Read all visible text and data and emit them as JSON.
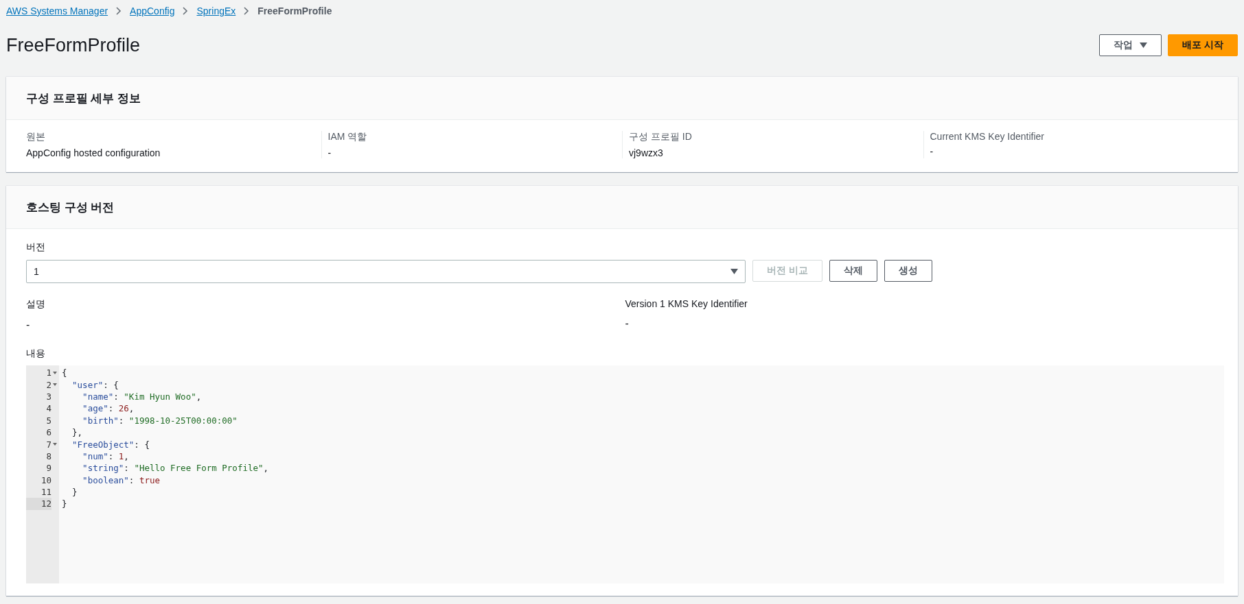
{
  "breadcrumb": [
    {
      "label": "AWS Systems Manager",
      "link": true
    },
    {
      "label": "AppConfig",
      "link": true
    },
    {
      "label": "SpringEx",
      "link": true
    },
    {
      "label": "FreeFormProfile",
      "link": false
    }
  ],
  "header": {
    "title": "FreeFormProfile",
    "actions": [
      {
        "label": "작업",
        "kind": "dropdown"
      },
      {
        "label": "배포 시작",
        "kind": "primary"
      }
    ]
  },
  "details": {
    "title": "구성 프로필 세부 정보",
    "fields": [
      {
        "label": "원본",
        "value": "AppConfig hosted configuration"
      },
      {
        "label": "IAM 역할",
        "value": "-"
      },
      {
        "label": "구성 프로필 ID",
        "value": "vj9wzx3"
      },
      {
        "label": "Current KMS Key Identifier",
        "value": "-"
      }
    ]
  },
  "versions": {
    "title": "호스팅 구성 버전",
    "version_label": "버전",
    "version_select": "1",
    "buttons": [
      {
        "label": "버전 비교",
        "disabled": true
      },
      {
        "label": "삭제",
        "disabled": false
      },
      {
        "label": "생성",
        "disabled": false
      }
    ],
    "fields": [
      {
        "label": "설명",
        "value": "-"
      },
      {
        "label": "Version 1 KMS Key Identifier",
        "value": "-"
      }
    ],
    "content_label": "내용",
    "code": [
      {
        "number": "1",
        "foldable": true,
        "active": false,
        "tokens": [
          {
            "kind": "punct",
            "text": "{"
          }
        ]
      },
      {
        "number": "2",
        "foldable": true,
        "active": false,
        "tokens": [
          {
            "kind": "key",
            "text": "  \"user\""
          },
          {
            "kind": "punct",
            "text": ": {"
          }
        ]
      },
      {
        "number": "3",
        "foldable": false,
        "active": false,
        "tokens": [
          {
            "kind": "key",
            "text": "    \"name\""
          },
          {
            "kind": "punct",
            "text": ": "
          },
          {
            "kind": "string",
            "text": "\"Kim Hyun Woo\""
          },
          {
            "kind": "punct",
            "text": ","
          }
        ]
      },
      {
        "number": "4",
        "foldable": false,
        "active": false,
        "tokens": [
          {
            "kind": "key",
            "text": "    \"age\""
          },
          {
            "kind": "punct",
            "text": ": "
          },
          {
            "kind": "number",
            "text": "26"
          },
          {
            "kind": "punct",
            "text": ","
          }
        ]
      },
      {
        "number": "5",
        "foldable": false,
        "active": false,
        "tokens": [
          {
            "kind": "key",
            "text": "    \"birth\""
          },
          {
            "kind": "punct",
            "text": ": "
          },
          {
            "kind": "string",
            "text": "\"1998-10-25T00:00:00\""
          }
        ]
      },
      {
        "number": "6",
        "foldable": false,
        "active": false,
        "tokens": [
          {
            "kind": "punct",
            "text": "  },"
          }
        ]
      },
      {
        "number": "7",
        "foldable": true,
        "active": false,
        "tokens": [
          {
            "kind": "key",
            "text": "  \"FreeObject\""
          },
          {
            "kind": "punct",
            "text": ": {"
          }
        ]
      },
      {
        "number": "8",
        "foldable": false,
        "active": false,
        "tokens": [
          {
            "kind": "key",
            "text": "    \"num\""
          },
          {
            "kind": "punct",
            "text": ": "
          },
          {
            "kind": "number",
            "text": "1"
          },
          {
            "kind": "punct",
            "text": ","
          }
        ]
      },
      {
        "number": "9",
        "foldable": false,
        "active": false,
        "tokens": [
          {
            "kind": "key",
            "text": "    \"string\""
          },
          {
            "kind": "punct",
            "text": ": "
          },
          {
            "kind": "string",
            "text": "\"Hello Free Form Profile\""
          },
          {
            "kind": "punct",
            "text": ","
          }
        ]
      },
      {
        "number": "10",
        "foldable": false,
        "active": false,
        "tokens": [
          {
            "kind": "key",
            "text": "    \"boolean\""
          },
          {
            "kind": "punct",
            "text": ": "
          },
          {
            "kind": "boolean",
            "text": "true"
          }
        ]
      },
      {
        "number": "11",
        "foldable": false,
        "active": false,
        "tokens": [
          {
            "kind": "punct",
            "text": "  }"
          }
        ]
      },
      {
        "number": "12",
        "foldable": false,
        "active": true,
        "tokens": [
          {
            "kind": "punct",
            "text": "}"
          }
        ]
      }
    ]
  }
}
